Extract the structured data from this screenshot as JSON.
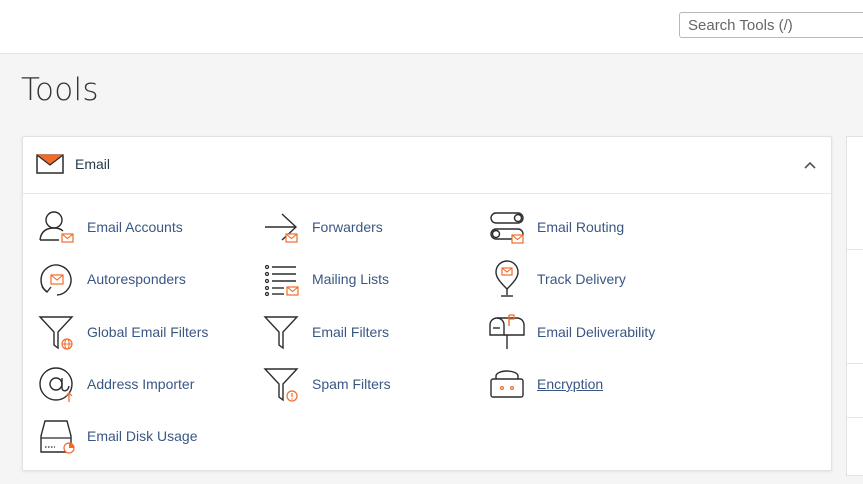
{
  "search": {
    "placeholder": "Search Tools (/)"
  },
  "page": {
    "title": "Tools"
  },
  "email_panel": {
    "title": "Email",
    "tools": {
      "email_accounts": "Email Accounts",
      "forwarders": "Forwarders",
      "email_routing": "Email Routing",
      "autoresponders": "Autoresponders",
      "mailing_lists": "Mailing Lists",
      "track_delivery": "Track Delivery",
      "global_email_filters": "Global Email Filters",
      "email_filters": "Email Filters",
      "email_deliverability": "Email Deliverability",
      "address_importer": "Address Importer",
      "spam_filters": "Spam Filters",
      "encryption": "Encryption",
      "email_disk_usage": "Email Disk Usage"
    }
  },
  "colors": {
    "accent": "#f26b2b",
    "icon_stroke": "#2b2b2b",
    "link": "#3a5783"
  }
}
